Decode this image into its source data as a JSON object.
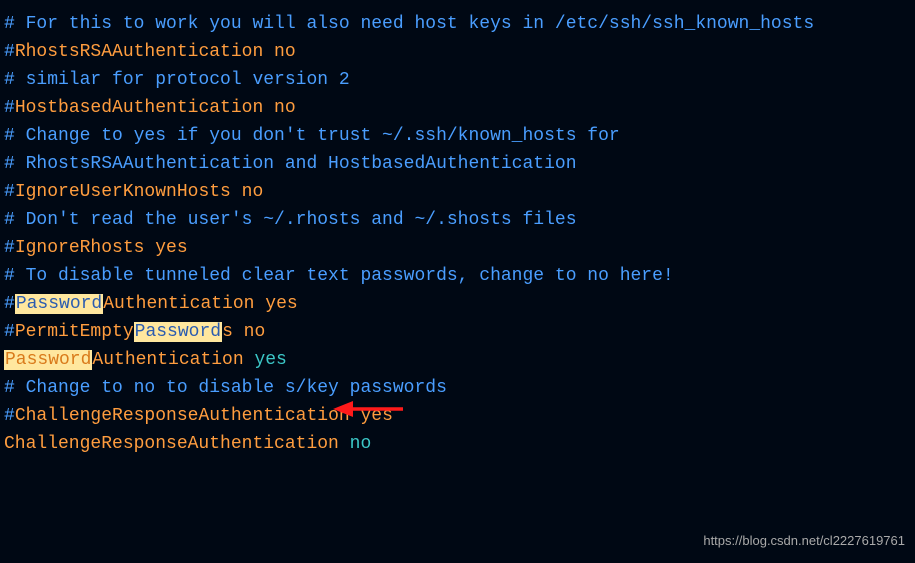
{
  "lines": {
    "l1": "# For this to work you will also need host keys in /etc/ssh/ssh_known_hosts",
    "l2a": "#",
    "l2b": "RhostsRSAAuthentication no",
    "l3": "# similar for protocol version 2",
    "l4a": "#",
    "l4b": "HostbasedAuthentication no",
    "l5": "# Change to yes if you don't trust ~/.ssh/known_hosts for",
    "l6": "# RhostsRSAAuthentication and HostbasedAuthentication",
    "l7a": "#",
    "l7b": "IgnoreUserKnownHosts no",
    "l8": "# Don't read the user's ~/.rhosts and ~/.shosts files",
    "l9a": "#",
    "l9b": "IgnoreRhosts yes",
    "l10": "",
    "l11": "# To disable tunneled clear text passwords, change to no here!",
    "l12a": "#",
    "l12b": "Password",
    "l12c": "Authentication yes",
    "l13a": "#",
    "l13b": "PermitEmpty",
    "l13c": "Password",
    "l13d": "s",
    "l13e": " no",
    "l14a": "Password",
    "l14b": "Authentication ",
    "l14c": "yes",
    "l15": "",
    "l16": "# Change to no to disable s/key passwords",
    "l17a": "#",
    "l17b": "ChallengeResponseAuthentication yes",
    "l18a": "ChallengeResponseAuthentication ",
    "l18b": "no"
  },
  "watermark": "https://blog.csdn.net/cl2227619761"
}
